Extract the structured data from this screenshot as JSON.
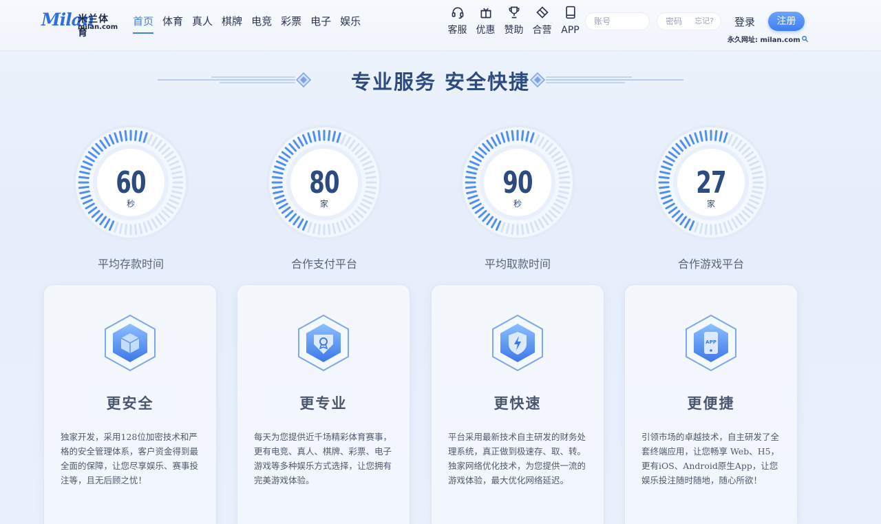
{
  "brand": {
    "script": "Milan",
    "name_cn": "米兰体育",
    "domain": "milan.com"
  },
  "nav": [
    {
      "label": "首页",
      "active": true
    },
    {
      "label": "体育"
    },
    {
      "label": "真人"
    },
    {
      "label": "棋牌"
    },
    {
      "label": "电竞"
    },
    {
      "label": "彩票"
    },
    {
      "label": "电子"
    },
    {
      "label": "娱乐"
    }
  ],
  "tools": [
    {
      "label": "客服",
      "icon": "headset-icon"
    },
    {
      "label": "优惠",
      "icon": "gift-icon"
    },
    {
      "label": "赞助",
      "icon": "trophy-icon"
    },
    {
      "label": "合营",
      "icon": "diamond-icon"
    },
    {
      "label": "APP",
      "icon": "tablet-icon"
    }
  ],
  "auth": {
    "account_placeholder": "账号",
    "password_placeholder": "密码",
    "forgot_label": "忘记?",
    "login_label": "登录",
    "register_label": "注册",
    "permanent_url": "永久网址: milan.com"
  },
  "section": {
    "title": "专业服务 安全快捷"
  },
  "stats": [
    {
      "value": "60",
      "unit": "秒",
      "label": "平均存款时间"
    },
    {
      "value": "80",
      "unit": "家",
      "label": "合作支付平台"
    },
    {
      "value": "90",
      "unit": "秒",
      "label": "平均取款时间"
    },
    {
      "value": "27",
      "unit": "家",
      "label": "合作游戏平台"
    }
  ],
  "features": [
    {
      "title": "更安全",
      "icon": "cube-shield-icon",
      "desc": "独家开发，采用128位加密技术和严格的安全管理体系，客户资金得到最全面的保障，让您尽享娱乐、赛事投注等，且无后顾之忧！"
    },
    {
      "title": "更专业",
      "icon": "award-badge-icon",
      "desc": "每天为您提供近千场精彩体育赛事，更有电竞、真人、棋牌、彩票、电子游戏等多种娱乐方式选择，让您拥有完美游戏体验。"
    },
    {
      "title": "更快速",
      "icon": "lightning-shield-icon",
      "desc": "平台采用最新技术自主研发的财务处理系统，真正做到极速存、取、转。独家网络优化技术，为您提供一流的游戏体验，最大优化网络延迟。"
    },
    {
      "title": "更便捷",
      "icon": "app-phone-icon",
      "desc": "引领市场的卓越技术，自主研发了全套终端应用，让您畅享 Web、H5，更有iOS、Android原生App，让您娱乐投注随时随地，随心所欲！"
    }
  ]
}
